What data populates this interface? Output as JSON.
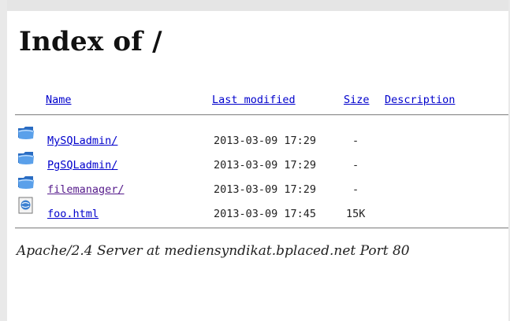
{
  "heading": "Index of /",
  "columns": {
    "name": "Name",
    "last_modified": "Last modified",
    "size": "Size",
    "description": "Description"
  },
  "rows": [
    {
      "icon": "folder-icon",
      "name": "MySQLadmin/",
      "modified": "2013-03-09 17:29",
      "size": "-",
      "visited": false
    },
    {
      "icon": "folder-icon",
      "name": "PgSQLadmin/",
      "modified": "2013-03-09 17:29",
      "size": "-",
      "visited": false
    },
    {
      "icon": "folder-icon",
      "name": "filemanager/",
      "modified": "2013-03-09 17:29",
      "size": "-",
      "visited": true
    },
    {
      "icon": "web-file-icon",
      "name": "foo.html",
      "modified": "2013-03-09 17:45",
      "size": "15K",
      "visited": false
    }
  ],
  "footer": "Apache/2.4 Server at mediensyndikat.bplaced.net Port 80",
  "colors": {
    "link": "#0000cc",
    "visited_link": "#551a8b",
    "folder_blue": "#3b7fd0"
  }
}
